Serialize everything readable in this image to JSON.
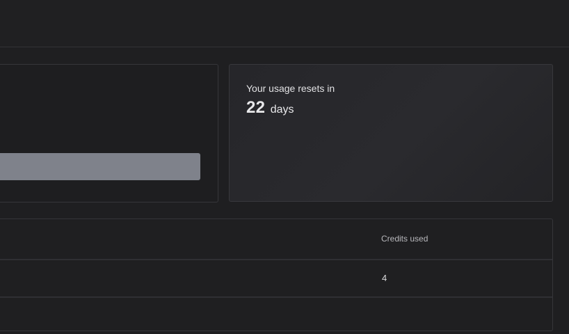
{
  "usage_reset": {
    "label": "Your usage resets in",
    "value": "22",
    "unit": "days"
  },
  "usage_table": {
    "columns": [
      "Credits used"
    ],
    "rows": [
      {
        "credits_used": "4"
      },
      {
        "credits_used": ""
      }
    ]
  },
  "colors": {
    "background": "#1f1f21",
    "card_border": "#36363a",
    "progress_fill": "#7f828b"
  }
}
